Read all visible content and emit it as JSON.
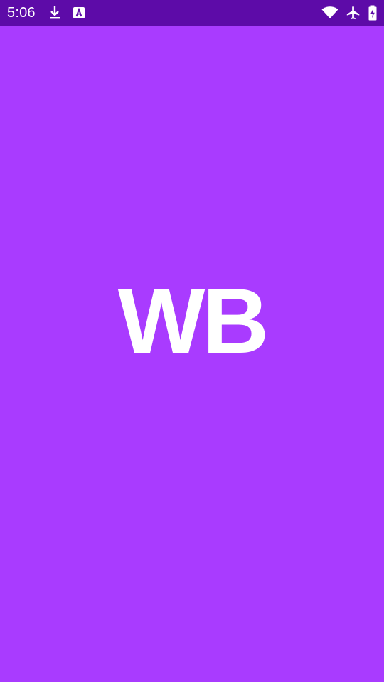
{
  "status_bar": {
    "time": "5:06",
    "left_icons": [
      "download-icon",
      "app-a-icon"
    ],
    "right_icons": [
      "wifi-icon",
      "airplane-icon",
      "battery-charging-icon"
    ],
    "background": "#5D0BA8"
  },
  "splash": {
    "logo_text": "WB",
    "background": "#A93BFF",
    "logo_color": "#FFFFFF"
  }
}
